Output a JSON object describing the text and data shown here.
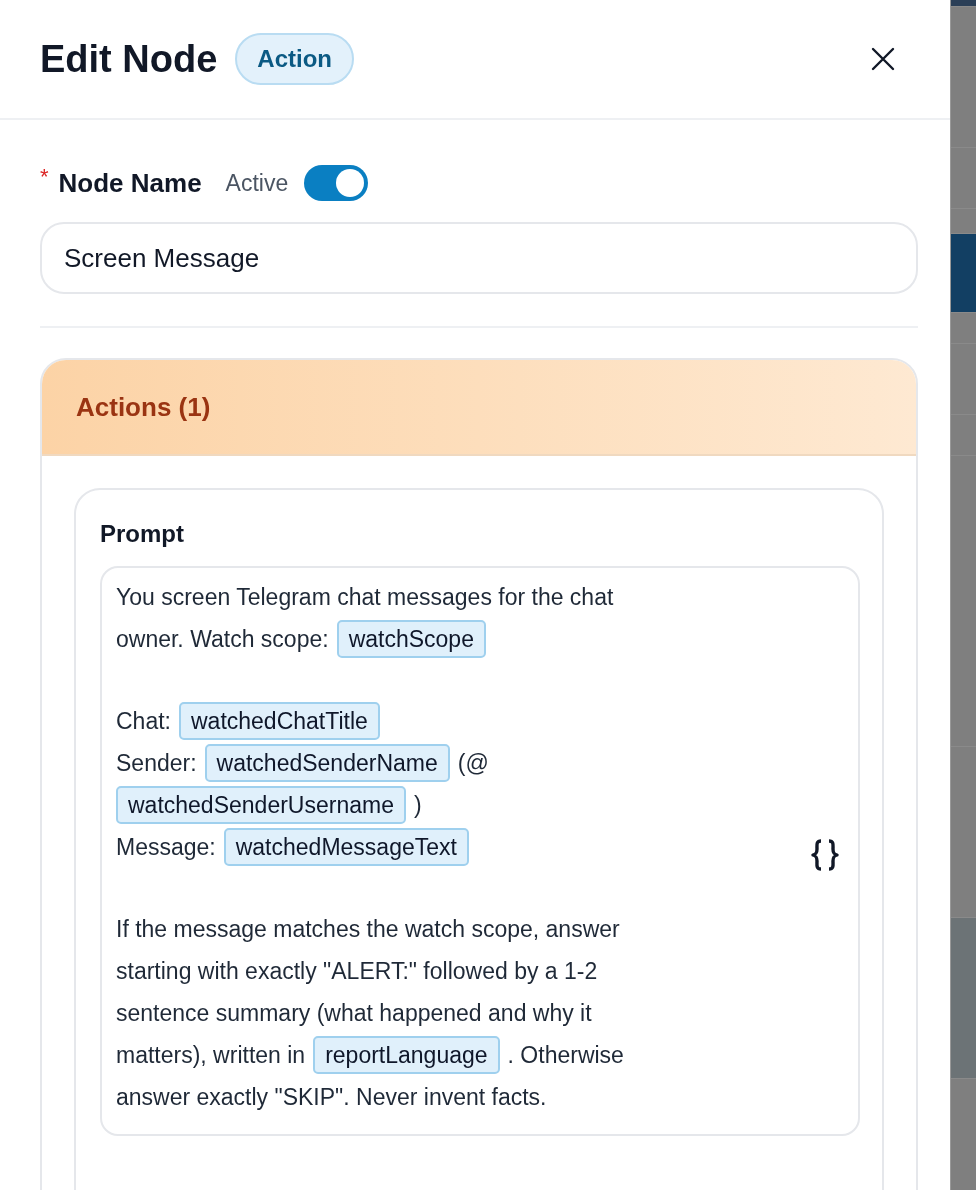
{
  "header": {
    "title": "Edit Node",
    "badge": "Action"
  },
  "node_name": {
    "label": "Node Name",
    "required": true,
    "required_mark": "*",
    "active_label": "Active",
    "active": true,
    "value": "Screen Message"
  },
  "actions": {
    "title": "Actions (1)",
    "prompt": {
      "label": "Prompt",
      "paragraphs": [
        [
          [
            {
              "kind": "text",
              "text": "You screen Telegram chat messages for the chat"
            }
          ],
          [
            {
              "kind": "text",
              "text": "owner. Watch scope:"
            },
            {
              "kind": "variable",
              "text": "watchScope"
            }
          ]
        ],
        [
          [
            {
              "kind": "text",
              "text": "Chat:"
            },
            {
              "kind": "variable",
              "text": "watchedChatTitle"
            }
          ],
          [
            {
              "kind": "text",
              "text": "Sender:"
            },
            {
              "kind": "variable",
              "text": "watchedSenderName"
            },
            {
              "kind": "text",
              "text": "(@"
            }
          ],
          [
            {
              "kind": "variable",
              "text": "watchedSenderUsername"
            },
            {
              "kind": "text",
              "text": ")"
            }
          ],
          [
            {
              "kind": "text",
              "text": "Message:"
            },
            {
              "kind": "variable",
              "text": "watchedMessageText"
            }
          ]
        ],
        [
          [
            {
              "kind": "text",
              "text": "If the message matches the watch scope, answer"
            }
          ],
          [
            {
              "kind": "text",
              "text": "starting with exactly \"ALERT:\" followed by a 1-2"
            }
          ],
          [
            {
              "kind": "text",
              "text": "sentence summary (what happened and why it"
            }
          ],
          [
            {
              "kind": "text",
              "text": "matters), written in"
            },
            {
              "kind": "variable",
              "text": "reportLanguage"
            },
            {
              "kind": "text",
              "text": ". Otherwise"
            }
          ],
          [
            {
              "kind": "text",
              "text": "answer exactly \"SKIP\". Never invent facts."
            }
          ]
        ]
      ]
    }
  }
}
